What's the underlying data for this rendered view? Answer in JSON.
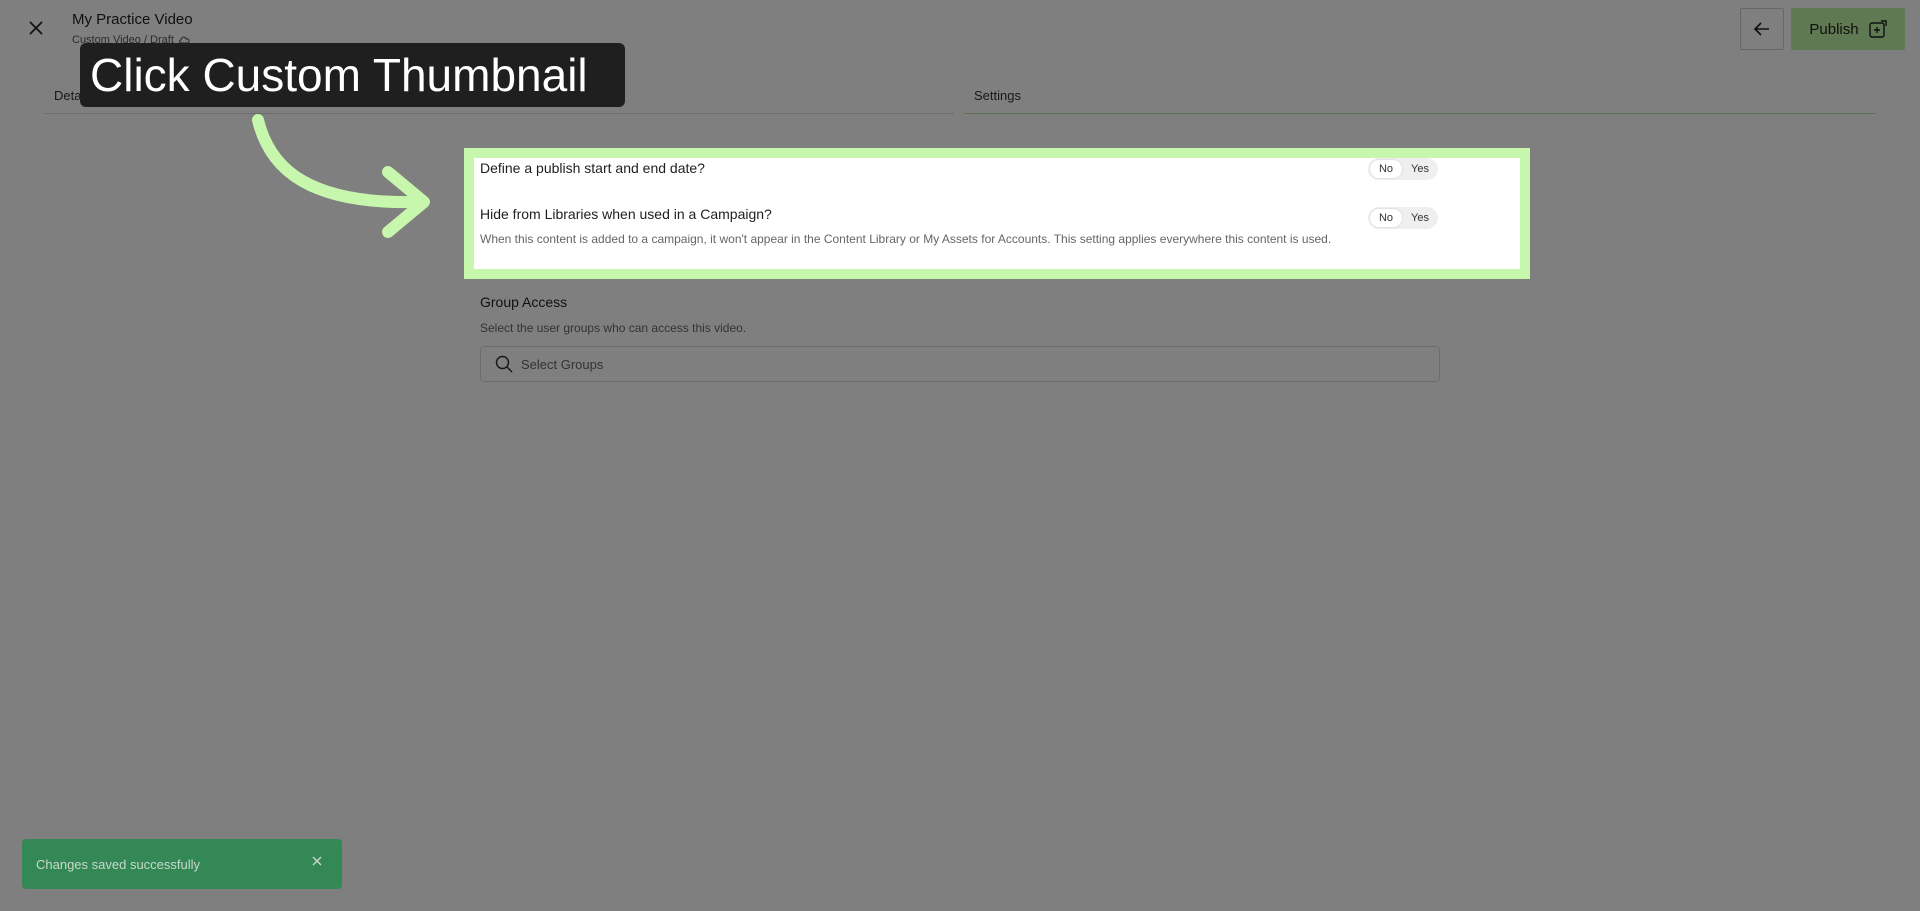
{
  "header": {
    "title": "My Practice Video",
    "breadcrumb": "Custom Video / Draft",
    "publish_label": "Publish",
    "close_icon": "close-icon",
    "back_icon": "arrow-left-icon",
    "publish_icon": "publish-plus-icon"
  },
  "tabs": [
    {
      "label": "Details"
    },
    {
      "label": "Settings"
    }
  ],
  "settings": {
    "publish_dates": {
      "question": "Define a publish start and end date?",
      "options": [
        "No",
        "Yes"
      ],
      "selected": "No"
    },
    "hide_libraries": {
      "question": "Hide from Libraries when used in a Campaign?",
      "description": "When this content is added to a campaign, it won't appear in the Content Library or My Assets for Accounts. This setting applies everywhere this content is used.",
      "options": [
        "No",
        "Yes"
      ],
      "selected": "No"
    }
  },
  "group_access": {
    "title": "Group Access",
    "description": "Select the user groups who can access this video.",
    "placeholder": "Select Groups"
  },
  "tutorial": {
    "callout": "Click Custom Thumbnail",
    "highlight_color": "#c7f7ac"
  },
  "toast": {
    "message": "Changes saved successfully",
    "color": "#338855"
  }
}
